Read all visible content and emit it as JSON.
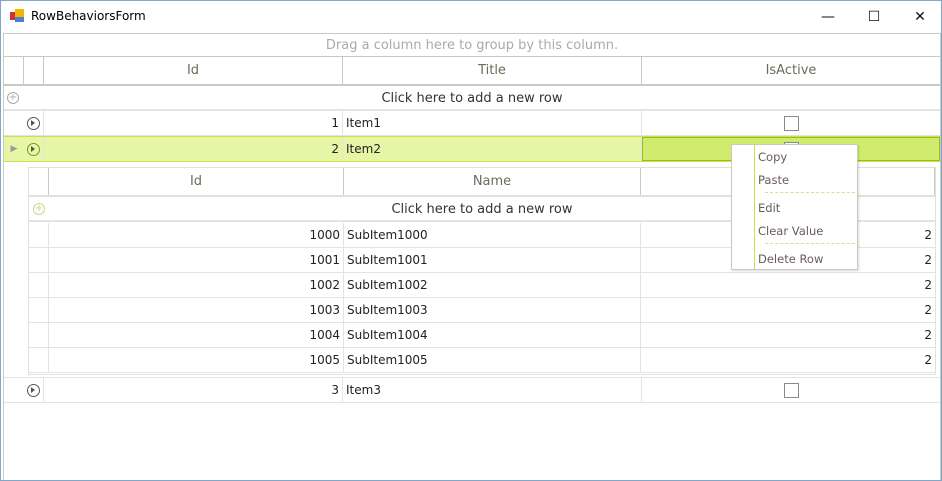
{
  "window": {
    "title": "RowBehaviorsForm",
    "minimize": "—",
    "maximize": "☐",
    "close": "✕"
  },
  "grid": {
    "group_panel": "Drag a column here to group by this column.",
    "columns": [
      "Id",
      "Title",
      "IsActive"
    ],
    "new_row": "Click here to add a new row",
    "rows": [
      {
        "id": "1",
        "title": "Item1",
        "active": false
      },
      {
        "id": "2",
        "title": "Item2",
        "active": false
      },
      {
        "id": "3",
        "title": "Item3",
        "active": false
      }
    ],
    "child": {
      "columns": [
        "Id",
        "Name",
        ""
      ],
      "new_row": "Click here to add a new row",
      "rows": [
        {
          "id": "1000",
          "name": "SubItem1000",
          "v": "2"
        },
        {
          "id": "1001",
          "name": "SubItem1001",
          "v": "2"
        },
        {
          "id": "1002",
          "name": "SubItem1002",
          "v": "2"
        },
        {
          "id": "1003",
          "name": "SubItem1003",
          "v": "2"
        },
        {
          "id": "1004",
          "name": "SubItem1004",
          "v": "2"
        },
        {
          "id": "1005",
          "name": "SubItem1005",
          "v": "2"
        }
      ]
    }
  },
  "context_menu": {
    "items": [
      "Copy",
      "Paste",
      "Edit",
      "Clear Value",
      "Delete Row"
    ]
  },
  "colors": {
    "selected_row": "#e6f5a6",
    "current_cell": "#d0ec6e",
    "accent": "#a6c81e"
  }
}
